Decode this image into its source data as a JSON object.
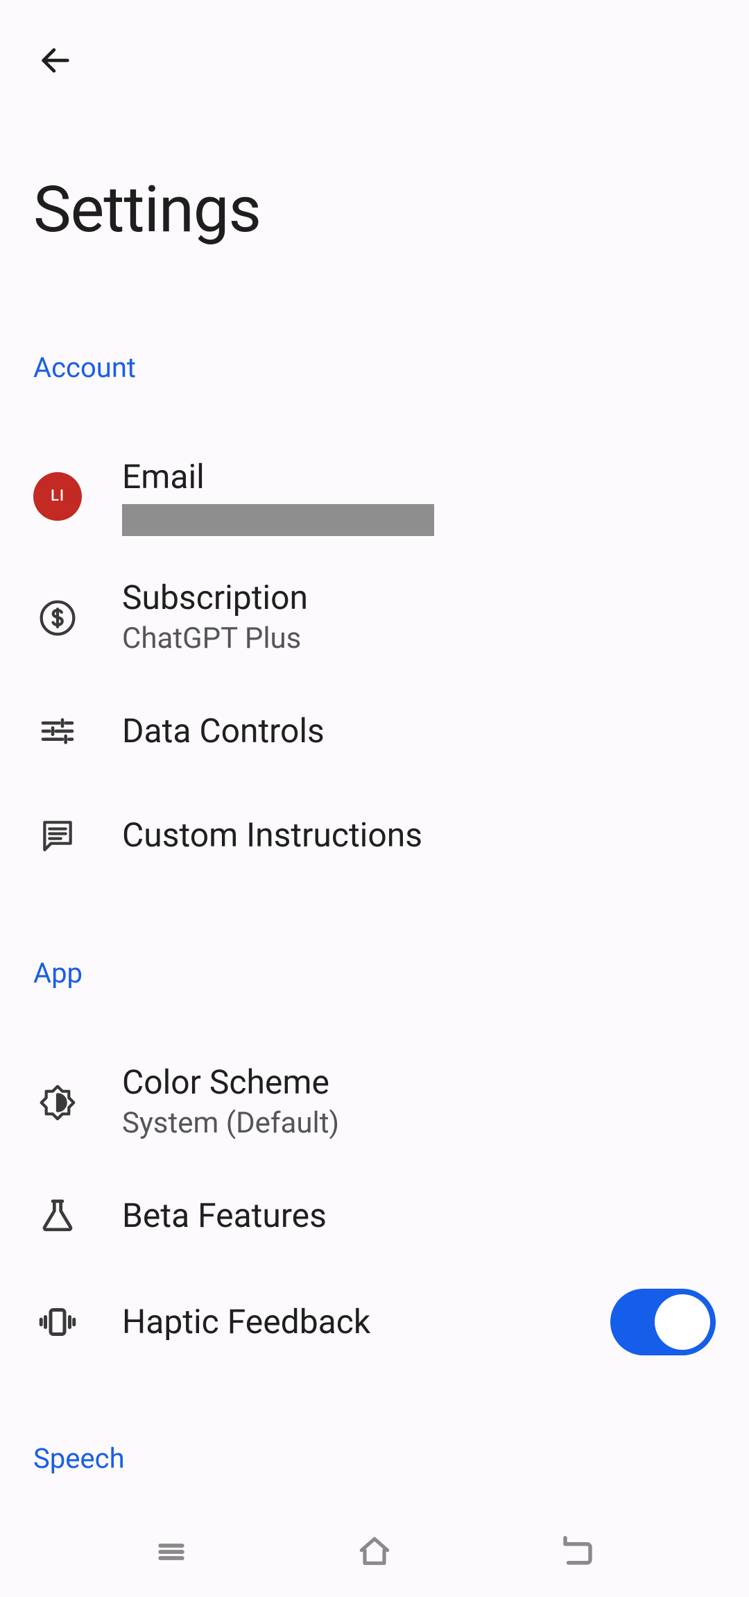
{
  "page": {
    "title": "Settings"
  },
  "sections": {
    "account": {
      "label": "Account",
      "email": {
        "title": "Email",
        "avatar_initials": "LI"
      },
      "subscription": {
        "title": "Subscription",
        "value": "ChatGPT Plus"
      },
      "data_controls": {
        "title": "Data Controls"
      },
      "custom_instructions": {
        "title": "Custom Instructions"
      }
    },
    "app": {
      "label": "App",
      "color_scheme": {
        "title": "Color Scheme",
        "value": "System (Default)"
      },
      "beta_features": {
        "title": "Beta Features"
      },
      "haptic_feedback": {
        "title": "Haptic Feedback",
        "enabled": true
      }
    },
    "speech": {
      "label": "Speech"
    }
  },
  "colors": {
    "link": "#1a5ee6",
    "avatar_bg": "#c22a23",
    "toggle_on": "#145eea"
  }
}
